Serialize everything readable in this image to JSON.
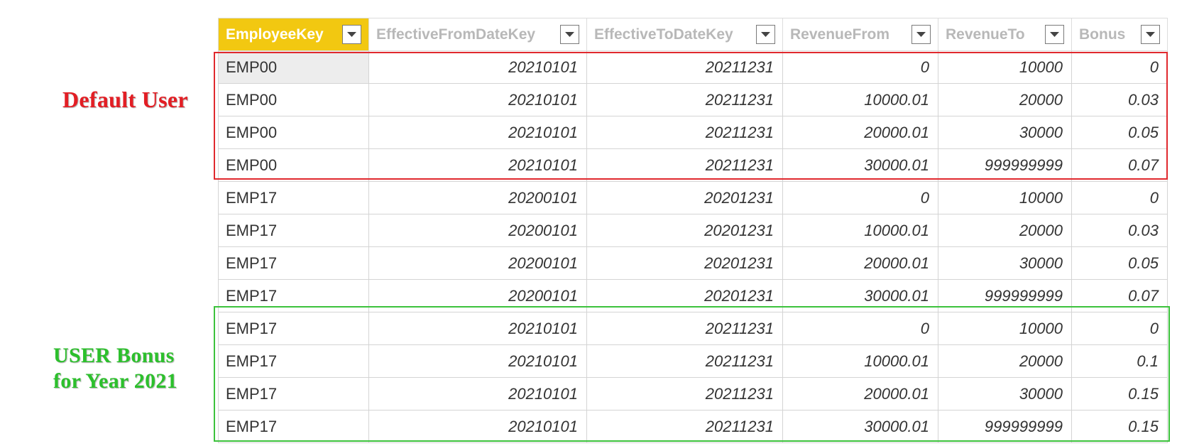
{
  "columns": [
    {
      "label": "EmployeeKey",
      "icon": "dropdown-arrow-icon"
    },
    {
      "label": "EffectiveFromDateKey",
      "icon": "dropdown-arrow-icon"
    },
    {
      "label": "EffectiveToDateKey",
      "icon": "dropdown-arrow-icon"
    },
    {
      "label": "RevenueFrom",
      "icon": "dropdown-arrow-icon"
    },
    {
      "label": "RevenueTo",
      "icon": "dropdown-arrow-icon"
    },
    {
      "label": "Bonus",
      "icon": "dropdown-arrow-icon"
    }
  ],
  "rows": [
    [
      "EMP00",
      "20210101",
      "20211231",
      "0",
      "10000",
      "0"
    ],
    [
      "EMP00",
      "20210101",
      "20211231",
      "10000.01",
      "20000",
      "0.03"
    ],
    [
      "EMP00",
      "20210101",
      "20211231",
      "20000.01",
      "30000",
      "0.05"
    ],
    [
      "EMP00",
      "20210101",
      "20211231",
      "30000.01",
      "999999999",
      "0.07"
    ],
    [
      "EMP17",
      "20200101",
      "20201231",
      "0",
      "10000",
      "0"
    ],
    [
      "EMP17",
      "20200101",
      "20201231",
      "10000.01",
      "20000",
      "0.03"
    ],
    [
      "EMP17",
      "20200101",
      "20201231",
      "20000.01",
      "30000",
      "0.05"
    ],
    [
      "EMP17",
      "20200101",
      "20201231",
      "30000.01",
      "999999999",
      "0.07"
    ],
    [
      "EMP17",
      "20210101",
      "20211231",
      "0",
      "10000",
      "0"
    ],
    [
      "EMP17",
      "20210101",
      "20211231",
      "10000.01",
      "20000",
      "0.1"
    ],
    [
      "EMP17",
      "20210101",
      "20211231",
      "20000.01",
      "30000",
      "0.15"
    ],
    [
      "EMP17",
      "20210101",
      "20211231",
      "30000.01",
      "999999999",
      "0.15"
    ]
  ],
  "annotations": {
    "default_user": "Default User",
    "user_bonus_line1": "USER Bonus",
    "user_bonus_line2": "for Year 2021"
  },
  "colors": {
    "active_header": "#f2c811",
    "default_box": "#e0292e",
    "user_box": "#3cc23c"
  }
}
